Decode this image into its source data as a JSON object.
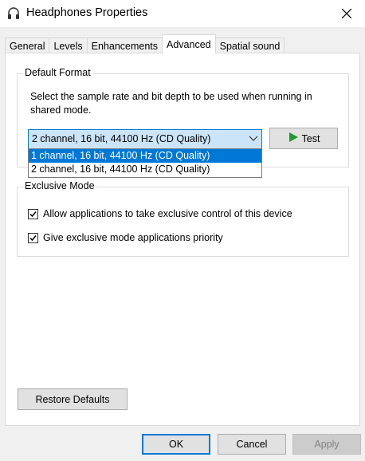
{
  "window": {
    "title": "Headphones Properties"
  },
  "tabs": [
    {
      "label": "General"
    },
    {
      "label": "Levels"
    },
    {
      "label": "Enhancements"
    },
    {
      "label": "Advanced"
    },
    {
      "label": "Spatial sound"
    }
  ],
  "default_format": {
    "title": "Default Format",
    "description": "Select the sample rate and bit depth to be used when running in shared mode.",
    "selected": "2 channel, 16 bit, 44100 Hz (CD Quality)",
    "options": [
      "1 channel, 16 bit, 44100 Hz (CD Quality)",
      "2 channel, 16 bit, 44100 Hz (CD Quality)"
    ],
    "test_label": "Test"
  },
  "exclusive_mode": {
    "title": "Exclusive Mode",
    "allow_label": "Allow applications to take exclusive control of this device",
    "priority_label": "Give exclusive mode applications priority"
  },
  "restore_label": "Restore Defaults",
  "buttons": {
    "ok": "OK",
    "cancel": "Cancel",
    "apply": "Apply"
  }
}
